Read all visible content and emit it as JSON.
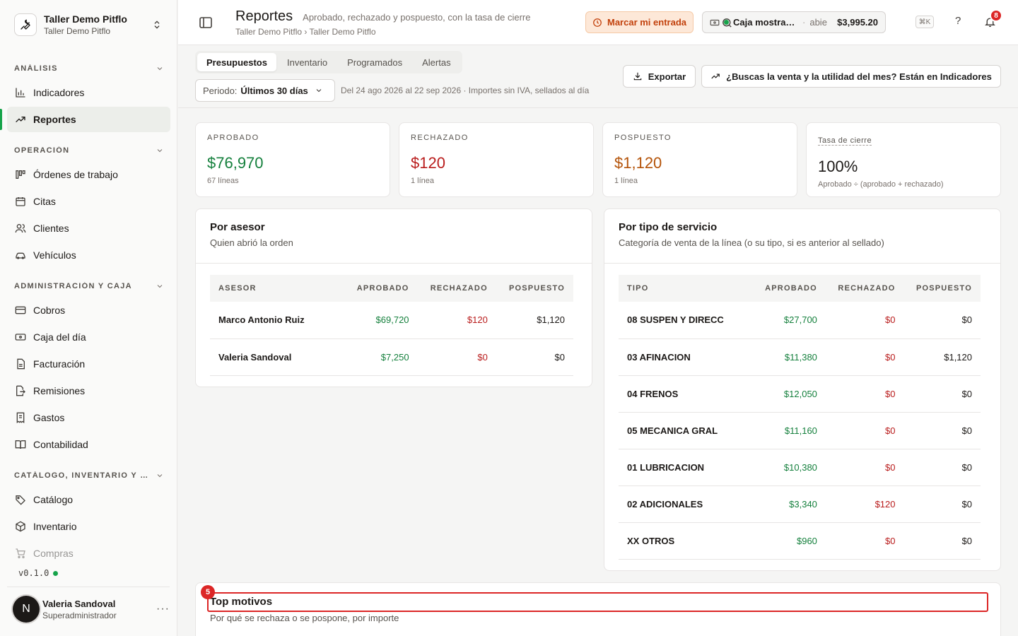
{
  "org": {
    "name": "Taller Demo Pitflo",
    "subtitle": "Taller Demo Pitflo"
  },
  "sidebar": {
    "sections": [
      {
        "label": "ANÁLISIS",
        "items": [
          "Indicadores",
          "Reportes"
        ]
      },
      {
        "label": "OPERACIÓN",
        "items": [
          "Órdenes de trabajo",
          "Citas",
          "Clientes",
          "Vehículos"
        ]
      },
      {
        "label": "ADMINISTRACIÓN Y CAJA",
        "items": [
          "Cobros",
          "Caja del día",
          "Facturación",
          "Remisiones",
          "Gastos",
          "Contabilidad"
        ]
      },
      {
        "label": "CATÁLOGO, INVENTARIO Y COMPRAS",
        "items": [
          "Catálogo",
          "Inventario",
          "Compras"
        ]
      }
    ],
    "active_item": "Reportes",
    "version": "v0.1.0",
    "user": {
      "initial": "N",
      "name": "Valeria Sandoval",
      "role": "Superadministrador"
    }
  },
  "header": {
    "title": "Reportes",
    "description": "Aprobado, rechazado y pospuesto, con la tasa de cierre",
    "breadcrumb": "Taller Demo Pitflo › Taller Demo Pitflo",
    "entry_button": "Marcar mi entrada",
    "cash": {
      "name": "Caja mostrador",
      "separator": "·",
      "status": "abie",
      "amount": "$3,995.20"
    },
    "shortcut": "⌘K",
    "help": "?",
    "notifications": "8"
  },
  "toolbar": {
    "tabs": [
      "Presupuestos",
      "Inventario",
      "Programados",
      "Alertas"
    ],
    "period_label": "Periodo:",
    "period_value": "Últimos 30 días",
    "range_text": "Del 24 ago 2026 al 22 sep 2026 · Importes sin IVA, sellados al día",
    "export_label": "Exportar",
    "indicators_link": "¿Buscas la venta y la utilidad del mes? Están en Indicadores"
  },
  "stats": [
    {
      "key": "APROBADO",
      "value": "$76,970",
      "sub": "67 líneas",
      "color": "#15803d"
    },
    {
      "key": "RECHAZADO",
      "value": "$120",
      "sub": "1 línea",
      "color": "#b91c1c"
    },
    {
      "key": "POSPUESTO",
      "value": "$1,120",
      "sub": "1 línea",
      "color": "#b45309"
    },
    {
      "key": "Tasa de cierre",
      "value": "100%",
      "sub": "Aprobado ÷ (aprobado + rechazado)",
      "color": "#1c1917"
    }
  ],
  "by_advisor": {
    "title": "Por asesor",
    "subtitle": "Quien abrió la orden",
    "columns": [
      "ASESOR",
      "APROBADO",
      "RECHAZADO",
      "POSPUESTO"
    ],
    "rows": [
      [
        "Marco Antonio Ruiz",
        "$69,720",
        "$120",
        "$1,120"
      ],
      [
        "Valeria Sandoval",
        "$7,250",
        "$0",
        "$0"
      ]
    ]
  },
  "by_service": {
    "title": "Por tipo de servicio",
    "subtitle": "Categoría de venta de la línea (o su tipo, si es anterior al sellado)",
    "columns": [
      "TIPO",
      "APROBADO",
      "RECHAZADO",
      "POSPUESTO"
    ],
    "rows": [
      [
        "08 SUSPEN Y DIRECC",
        "$27,700",
        "$0",
        "$0"
      ],
      [
        "03 AFINACION",
        "$11,380",
        "$0",
        "$1,120"
      ],
      [
        "04 FRENOS",
        "$12,050",
        "$0",
        "$0"
      ],
      [
        "05 MECANICA GRAL",
        "$11,160",
        "$0",
        "$0"
      ],
      [
        "01 LUBRICACION",
        "$10,380",
        "$0",
        "$0"
      ],
      [
        "02 ADICIONALES",
        "$3,340",
        "$120",
        "$0"
      ],
      [
        "XX OTROS",
        "$960",
        "$0",
        "$0"
      ]
    ]
  },
  "top_reasons": {
    "marker": "5",
    "title": "Top motivos",
    "subtitle": "Por qué se rechaza o se pospone, por importe"
  }
}
